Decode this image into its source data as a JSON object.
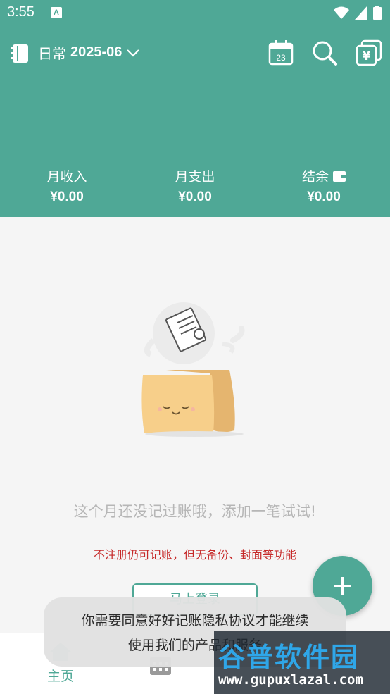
{
  "status_bar": {
    "time": "3:55",
    "notification_glyph": "A",
    "icons": [
      "wifi-icon",
      "signal-icon",
      "battery-icon"
    ]
  },
  "header": {
    "book_name": "日常",
    "month": "2025-06",
    "calendar_day": "23",
    "icons": [
      "book-icon",
      "chevron-down-icon",
      "calendar-icon",
      "search-icon",
      "bills-icon"
    ],
    "accent_color": "#4fa896"
  },
  "summary": {
    "income_label": "月收入",
    "income_value": "¥0.00",
    "expense_label": "月支出",
    "expense_value": "¥0.00",
    "balance_label": "结余",
    "balance_value": "¥0.00"
  },
  "main": {
    "empty_message": "这个月还没记过账哦，添加一笔试试!",
    "warning_message": "不注册仍可记账，但无备份、封面等功能",
    "login_button": "马上登录",
    "warning_color": "#c62828"
  },
  "fab": {
    "icon": "plus-icon"
  },
  "bottom_nav": {
    "home_label": "主页",
    "icons": [
      "home-icon",
      "stats-icon"
    ]
  },
  "toast": {
    "line1": "你需要同意好好记账隐私协议才能继续",
    "line2": "使用我们的产品和服务"
  },
  "watermark": {
    "brand": "谷普软件园",
    "url": "www.gupuxlazal.com"
  }
}
